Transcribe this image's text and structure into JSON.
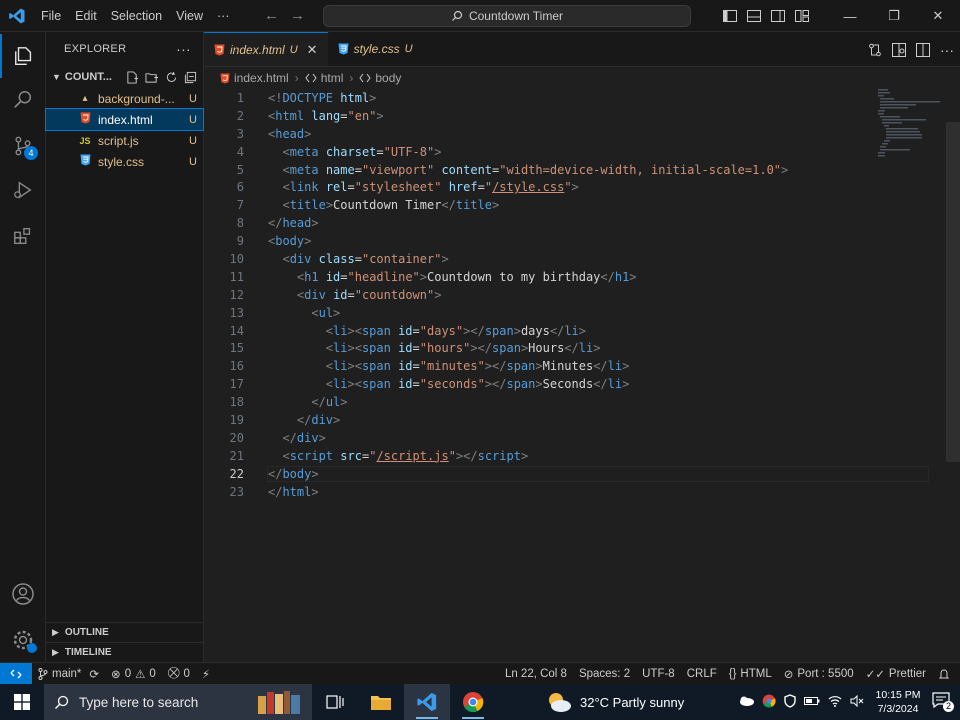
{
  "titlebar": {
    "menu": [
      "File",
      "Edit",
      "Selection",
      "View",
      "···"
    ],
    "command_center": "Countdown Timer"
  },
  "activitybar": {
    "scm_badge": "4"
  },
  "sidebar": {
    "header": "EXPLORER",
    "folder": "COUNT...",
    "files": [
      {
        "name": "background-...",
        "status": "U",
        "icon": "image-file-icon"
      },
      {
        "name": "index.html",
        "status": "U",
        "icon": "html-file-icon"
      },
      {
        "name": "script.js",
        "status": "U",
        "icon": "js-file-icon"
      },
      {
        "name": "style.css",
        "status": "U",
        "icon": "css-file-icon"
      }
    ],
    "outline": "OUTLINE",
    "timeline": "TIMELINE"
  },
  "tabs": [
    {
      "name": "index.html",
      "status": "U",
      "close": "✕"
    },
    {
      "name": "style.css",
      "status": "U"
    }
  ],
  "breadcrumb": [
    "index.html",
    "html",
    "body"
  ],
  "editor": {
    "current_line": 22,
    "lines": [
      {
        "n": "1",
        "segments": [
          [
            "p",
            "<!"
          ],
          [
            "t",
            "DOCTYPE"
          ],
          [
            "x",
            " "
          ],
          [
            "a",
            "html"
          ],
          [
            "p",
            ">"
          ]
        ]
      },
      {
        "n": "2",
        "segments": [
          [
            "p",
            "<"
          ],
          [
            "t",
            "html"
          ],
          [
            "x",
            " "
          ],
          [
            "a",
            "lang"
          ],
          [
            "x",
            "="
          ],
          [
            "s",
            "\"en\""
          ],
          [
            "p",
            ">"
          ]
        ]
      },
      {
        "n": "3",
        "segments": [
          [
            "p",
            "<"
          ],
          [
            "t",
            "head"
          ],
          [
            "p",
            ">"
          ]
        ]
      },
      {
        "n": "4",
        "segments": [
          [
            "x",
            "  "
          ],
          [
            "p",
            "<"
          ],
          [
            "t",
            "meta"
          ],
          [
            "x",
            " "
          ],
          [
            "a",
            "charset"
          ],
          [
            "x",
            "="
          ],
          [
            "s",
            "\"UTF-8\""
          ],
          [
            "p",
            ">"
          ]
        ]
      },
      {
        "n": "5",
        "segments": [
          [
            "x",
            "  "
          ],
          [
            "p",
            "<"
          ],
          [
            "t",
            "meta"
          ],
          [
            "x",
            " "
          ],
          [
            "a",
            "name"
          ],
          [
            "x",
            "="
          ],
          [
            "s",
            "\"viewport\""
          ],
          [
            "x",
            " "
          ],
          [
            "a",
            "content"
          ],
          [
            "x",
            "="
          ],
          [
            "s",
            "\"width=device-width, initial-scale=1.0\""
          ],
          [
            "p",
            ">"
          ]
        ]
      },
      {
        "n": "6",
        "segments": [
          [
            "x",
            "  "
          ],
          [
            "p",
            "<"
          ],
          [
            "t",
            "link"
          ],
          [
            "x",
            " "
          ],
          [
            "a",
            "rel"
          ],
          [
            "x",
            "="
          ],
          [
            "s",
            "\"stylesheet\""
          ],
          [
            "x",
            " "
          ],
          [
            "a",
            "href"
          ],
          [
            "x",
            "="
          ],
          [
            "s",
            "\""
          ],
          [
            "l",
            "/style.css"
          ],
          [
            "s",
            "\""
          ],
          [
            "p",
            ">"
          ]
        ]
      },
      {
        "n": "7",
        "segments": [
          [
            "x",
            "  "
          ],
          [
            "p",
            "<"
          ],
          [
            "t",
            "title"
          ],
          [
            "p",
            ">"
          ],
          [
            "x",
            "Countdown Timer"
          ],
          [
            "p",
            "</"
          ],
          [
            "t",
            "title"
          ],
          [
            "p",
            ">"
          ]
        ]
      },
      {
        "n": "8",
        "segments": [
          [
            "p",
            "</"
          ],
          [
            "t",
            "head"
          ],
          [
            "p",
            ">"
          ]
        ]
      },
      {
        "n": "9",
        "segments": [
          [
            "p",
            "<"
          ],
          [
            "t",
            "body"
          ],
          [
            "p",
            ">"
          ]
        ]
      },
      {
        "n": "10",
        "segments": [
          [
            "x",
            "  "
          ],
          [
            "p",
            "<"
          ],
          [
            "t",
            "div"
          ],
          [
            "x",
            " "
          ],
          [
            "a",
            "class"
          ],
          [
            "x",
            "="
          ],
          [
            "s",
            "\"container\""
          ],
          [
            "p",
            ">"
          ]
        ]
      },
      {
        "n": "11",
        "segments": [
          [
            "x",
            "    "
          ],
          [
            "p",
            "<"
          ],
          [
            "t",
            "h1"
          ],
          [
            "x",
            " "
          ],
          [
            "a",
            "id"
          ],
          [
            "x",
            "="
          ],
          [
            "s",
            "\"headline\""
          ],
          [
            "p",
            ">"
          ],
          [
            "x",
            "Countdown to my birthday"
          ],
          [
            "p",
            "</"
          ],
          [
            "t",
            "h1"
          ],
          [
            "p",
            ">"
          ]
        ]
      },
      {
        "n": "12",
        "segments": [
          [
            "x",
            "    "
          ],
          [
            "p",
            "<"
          ],
          [
            "t",
            "div"
          ],
          [
            "x",
            " "
          ],
          [
            "a",
            "id"
          ],
          [
            "x",
            "="
          ],
          [
            "s",
            "\"countdown\""
          ],
          [
            "p",
            ">"
          ]
        ]
      },
      {
        "n": "13",
        "segments": [
          [
            "x",
            "      "
          ],
          [
            "p",
            "<"
          ],
          [
            "t",
            "ul"
          ],
          [
            "p",
            ">"
          ]
        ]
      },
      {
        "n": "14",
        "segments": [
          [
            "x",
            "        "
          ],
          [
            "p",
            "<"
          ],
          [
            "t",
            "li"
          ],
          [
            "p",
            "><"
          ],
          [
            "t",
            "span"
          ],
          [
            "x",
            " "
          ],
          [
            "a",
            "id"
          ],
          [
            "x",
            "="
          ],
          [
            "s",
            "\"days\""
          ],
          [
            "p",
            "></"
          ],
          [
            "t",
            "span"
          ],
          [
            "p",
            ">"
          ],
          [
            "x",
            "days"
          ],
          [
            "p",
            "</"
          ],
          [
            "t",
            "li"
          ],
          [
            "p",
            ">"
          ]
        ]
      },
      {
        "n": "15",
        "segments": [
          [
            "x",
            "        "
          ],
          [
            "p",
            "<"
          ],
          [
            "t",
            "li"
          ],
          [
            "p",
            "><"
          ],
          [
            "t",
            "span"
          ],
          [
            "x",
            " "
          ],
          [
            "a",
            "id"
          ],
          [
            "x",
            "="
          ],
          [
            "s",
            "\"hours\""
          ],
          [
            "p",
            "></"
          ],
          [
            "t",
            "span"
          ],
          [
            "p",
            ">"
          ],
          [
            "x",
            "Hours"
          ],
          [
            "p",
            "</"
          ],
          [
            "t",
            "li"
          ],
          [
            "p",
            ">"
          ]
        ]
      },
      {
        "n": "16",
        "segments": [
          [
            "x",
            "        "
          ],
          [
            "p",
            "<"
          ],
          [
            "t",
            "li"
          ],
          [
            "p",
            "><"
          ],
          [
            "t",
            "span"
          ],
          [
            "x",
            " "
          ],
          [
            "a",
            "id"
          ],
          [
            "x",
            "="
          ],
          [
            "s",
            "\"minutes\""
          ],
          [
            "p",
            "></"
          ],
          [
            "t",
            "span"
          ],
          [
            "p",
            ">"
          ],
          [
            "x",
            "Minutes"
          ],
          [
            "p",
            "</"
          ],
          [
            "t",
            "li"
          ],
          [
            "p",
            ">"
          ]
        ]
      },
      {
        "n": "17",
        "segments": [
          [
            "x",
            "        "
          ],
          [
            "p",
            "<"
          ],
          [
            "t",
            "li"
          ],
          [
            "p",
            "><"
          ],
          [
            "t",
            "span"
          ],
          [
            "x",
            " "
          ],
          [
            "a",
            "id"
          ],
          [
            "x",
            "="
          ],
          [
            "s",
            "\"seconds\""
          ],
          [
            "p",
            "></"
          ],
          [
            "t",
            "span"
          ],
          [
            "p",
            ">"
          ],
          [
            "x",
            "Seconds"
          ],
          [
            "p",
            "</"
          ],
          [
            "t",
            "li"
          ],
          [
            "p",
            ">"
          ]
        ]
      },
      {
        "n": "18",
        "segments": [
          [
            "x",
            "      "
          ],
          [
            "p",
            "</"
          ],
          [
            "t",
            "ul"
          ],
          [
            "p",
            ">"
          ]
        ]
      },
      {
        "n": "19",
        "segments": [
          [
            "x",
            "    "
          ],
          [
            "p",
            "</"
          ],
          [
            "t",
            "div"
          ],
          [
            "p",
            ">"
          ]
        ]
      },
      {
        "n": "20",
        "segments": [
          [
            "x",
            "  "
          ],
          [
            "p",
            "</"
          ],
          [
            "t",
            "div"
          ],
          [
            "p",
            ">"
          ]
        ]
      },
      {
        "n": "21",
        "segments": [
          [
            "x",
            "  "
          ],
          [
            "p",
            "<"
          ],
          [
            "t",
            "script"
          ],
          [
            "x",
            " "
          ],
          [
            "a",
            "src"
          ],
          [
            "x",
            "="
          ],
          [
            "s",
            "\""
          ],
          [
            "l",
            "/script.js"
          ],
          [
            "s",
            "\""
          ],
          [
            "p",
            "></"
          ],
          [
            "t",
            "script"
          ],
          [
            "p",
            ">"
          ]
        ]
      },
      {
        "n": "22",
        "segments": [
          [
            "p",
            "</"
          ],
          [
            "t",
            "body"
          ],
          [
            "p",
            ">"
          ]
        ]
      },
      {
        "n": "23",
        "segments": [
          [
            "p",
            "</"
          ],
          [
            "t",
            "html"
          ],
          [
            "p",
            ">"
          ]
        ]
      }
    ]
  },
  "statusbar": {
    "branch": "main*",
    "errors": "0",
    "warnings": "0",
    "ports": "0",
    "position": "Ln 22, Col 8",
    "spaces": "Spaces: 2",
    "encoding": "UTF-8",
    "eol": "CRLF",
    "language": "HTML",
    "live_server": "Port : 5500",
    "prettier": "Prettier"
  },
  "taskbar": {
    "search_placeholder": "Type here to search",
    "weather": "32°C  Partly sunny",
    "time": "10:15 PM",
    "date": "7/3/2024",
    "notifications": "2"
  },
  "colors": {
    "accent": "#0078d4",
    "untracked": "#e2c08d",
    "tag": "#569cd6",
    "attribute": "#9cdcfe",
    "string": "#ce9178"
  }
}
